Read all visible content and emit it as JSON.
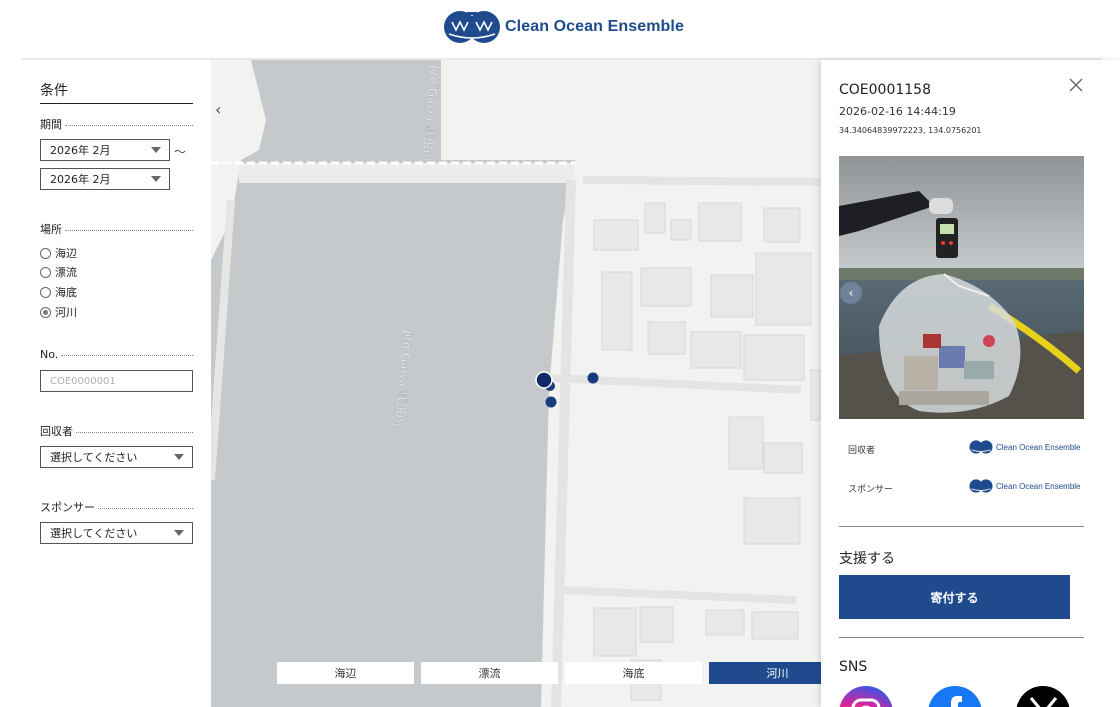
{
  "header": {
    "brand_name": "Clean Ocean Ensemble"
  },
  "filters": {
    "title": "条件",
    "period": {
      "label": "期間",
      "from": "2026年 2月",
      "to": "2026年 2月",
      "separator": "～"
    },
    "location": {
      "label": "場所",
      "options": [
        {
          "label": "海辺",
          "selected": false
        },
        {
          "label": "漂流",
          "selected": false
        },
        {
          "label": "海底",
          "selected": false
        },
        {
          "label": "河川",
          "selected": true
        }
      ]
    },
    "number": {
      "label": "No.",
      "placeholder": "COE0000001"
    },
    "collector": {
      "label": "回収者",
      "value": "選択してください"
    },
    "sponsor": {
      "label": "スポンサー",
      "value": "選択してください"
    }
  },
  "map": {
    "river_label": "Jito Gawa 銭田川",
    "river_label_upper": "Jito Gawa 銭田川",
    "tabs": [
      {
        "label": "海辺",
        "active": false
      },
      {
        "label": "漂流",
        "active": false
      },
      {
        "label": "海底",
        "active": false
      },
      {
        "label": "河川",
        "active": true
      }
    ],
    "marker_color": "#1a3c7e"
  },
  "detail": {
    "id": "COE0001158",
    "datetime": "2026-02-16 14:44:19",
    "coordinates": "34.34064839972223, 134.0756201",
    "collector_label": "回収者",
    "collector_name": "Clean Ocean Ensemble",
    "sponsor_label": "スポンサー",
    "sponsor_name": "Clean Ocean Ensemble",
    "support_heading": "支援する",
    "donate_button": "寄付する",
    "sns_heading": "SNS",
    "sns": [
      "instagram-icon",
      "facebook-icon",
      "x-icon"
    ]
  },
  "colors": {
    "brand_blue": "#1f4b8e",
    "map_water": "#c5c9cc",
    "map_land": "#f2f2f0"
  }
}
